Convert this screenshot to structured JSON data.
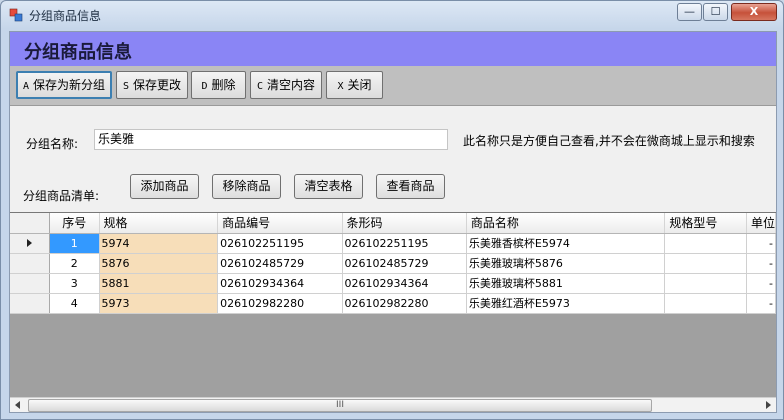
{
  "window": {
    "title": "分组商品信息",
    "controls": {
      "minimize": "—",
      "maximize": "☐",
      "close": "X"
    }
  },
  "header": {
    "title": "分组商品信息"
  },
  "toolbar": {
    "buttons": [
      {
        "key": "A",
        "label": "保存为新分组"
      },
      {
        "key": "S",
        "label": "保存更改"
      },
      {
        "key": "D",
        "label": "删除"
      },
      {
        "key": "C",
        "label": "清空内容"
      },
      {
        "key": "X",
        "label": "关闭"
      }
    ]
  },
  "form": {
    "group_name_label": "分组名称:",
    "group_name_value": "乐美雅",
    "hint": "此名称只是方便自己查看,并不会在微商城上显示和搜索",
    "list_label": "分组商品清单:"
  },
  "actions": {
    "add": "添加商品",
    "remove": "移除商品",
    "clear": "清空表格",
    "view": "查看商品"
  },
  "table": {
    "columns": [
      "序号",
      "规格",
      "商品编号",
      "条形码",
      "商品名称",
      "规格型号",
      "单位"
    ],
    "rows": [
      {
        "seq": "1",
        "spec": "5974",
        "code": "026102251195",
        "barcode": "026102251195",
        "name": "乐美雅香槟杯E5974",
        "model": "",
        "unit": "-"
      },
      {
        "seq": "2",
        "spec": "5876",
        "code": "026102485729",
        "barcode": "026102485729",
        "name": "乐美雅玻璃杯5876",
        "model": "",
        "unit": "-"
      },
      {
        "seq": "3",
        "spec": "5881",
        "code": "026102934364",
        "barcode": "026102934364",
        "name": "乐美雅玻璃杯5881",
        "model": "",
        "unit": "-"
      },
      {
        "seq": "4",
        "spec": "5973",
        "code": "026102982280",
        "barcode": "026102982280",
        "name": "乐美雅红酒杯E5973",
        "model": "",
        "unit": "-"
      }
    ],
    "scroll_thumb_grip": "III"
  },
  "colors": {
    "header_band": "#8a85f5",
    "selection": "#3399ff",
    "spec_highlight": "#f7deb9"
  }
}
